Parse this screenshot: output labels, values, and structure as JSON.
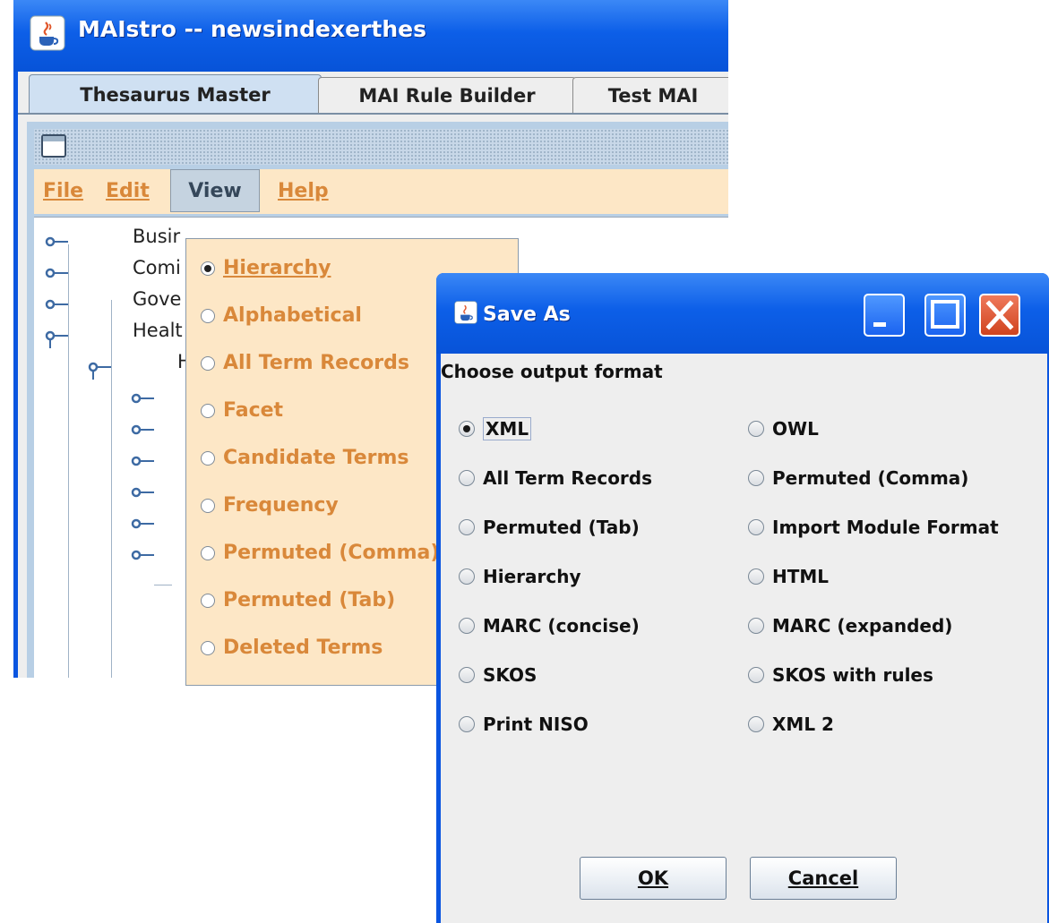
{
  "main_window": {
    "title": "MAIstro -- newsindexerthes",
    "tabs": [
      "Thesaurus Master",
      "MAI Rule Builder",
      "Test MAI"
    ],
    "menus": [
      "File",
      "Edit",
      "View",
      "Help"
    ],
    "tree_items": [
      "Busir",
      "Comi",
      "Gove",
      "Healt",
      "H"
    ]
  },
  "view_menu": {
    "items": [
      {
        "label": "Hierarchy",
        "selected": true
      },
      {
        "label": "Alphabetical",
        "selected": false
      },
      {
        "label": "All Term Records",
        "selected": false
      },
      {
        "label": "Facet",
        "selected": false
      },
      {
        "label": "Candidate Terms",
        "selected": false
      },
      {
        "label": "Frequency",
        "selected": false
      },
      {
        "label": "Permuted (Comma)",
        "selected": false
      },
      {
        "label": "Permuted (Tab)",
        "selected": false
      },
      {
        "label": "Deleted Terms",
        "selected": false
      }
    ]
  },
  "save_dialog": {
    "title": "Save As",
    "prompt": "Choose output format",
    "left_options": [
      "XML",
      "All Term Records",
      "Permuted (Tab)",
      "Hierarchy",
      "MARC (concise)",
      "SKOS",
      "Print NISO"
    ],
    "right_options": [
      "OWL",
      "Permuted (Comma)",
      "Import Module Format",
      "HTML",
      "MARC (expanded)",
      "SKOS with rules",
      "XML 2"
    ],
    "selected": "XML",
    "ok_label": "OK",
    "cancel_label": "Cancel"
  },
  "colors": {
    "titlebar_blue": "#0a55e0",
    "menu_background": "#fde7c6",
    "menu_text": "#d9883a",
    "dialog_background": "#eeeeee"
  },
  "icons": [
    "java-cup-icon",
    "frame-icon",
    "tree-node-icon",
    "minimize-icon",
    "maximize-icon",
    "close-icon"
  ]
}
